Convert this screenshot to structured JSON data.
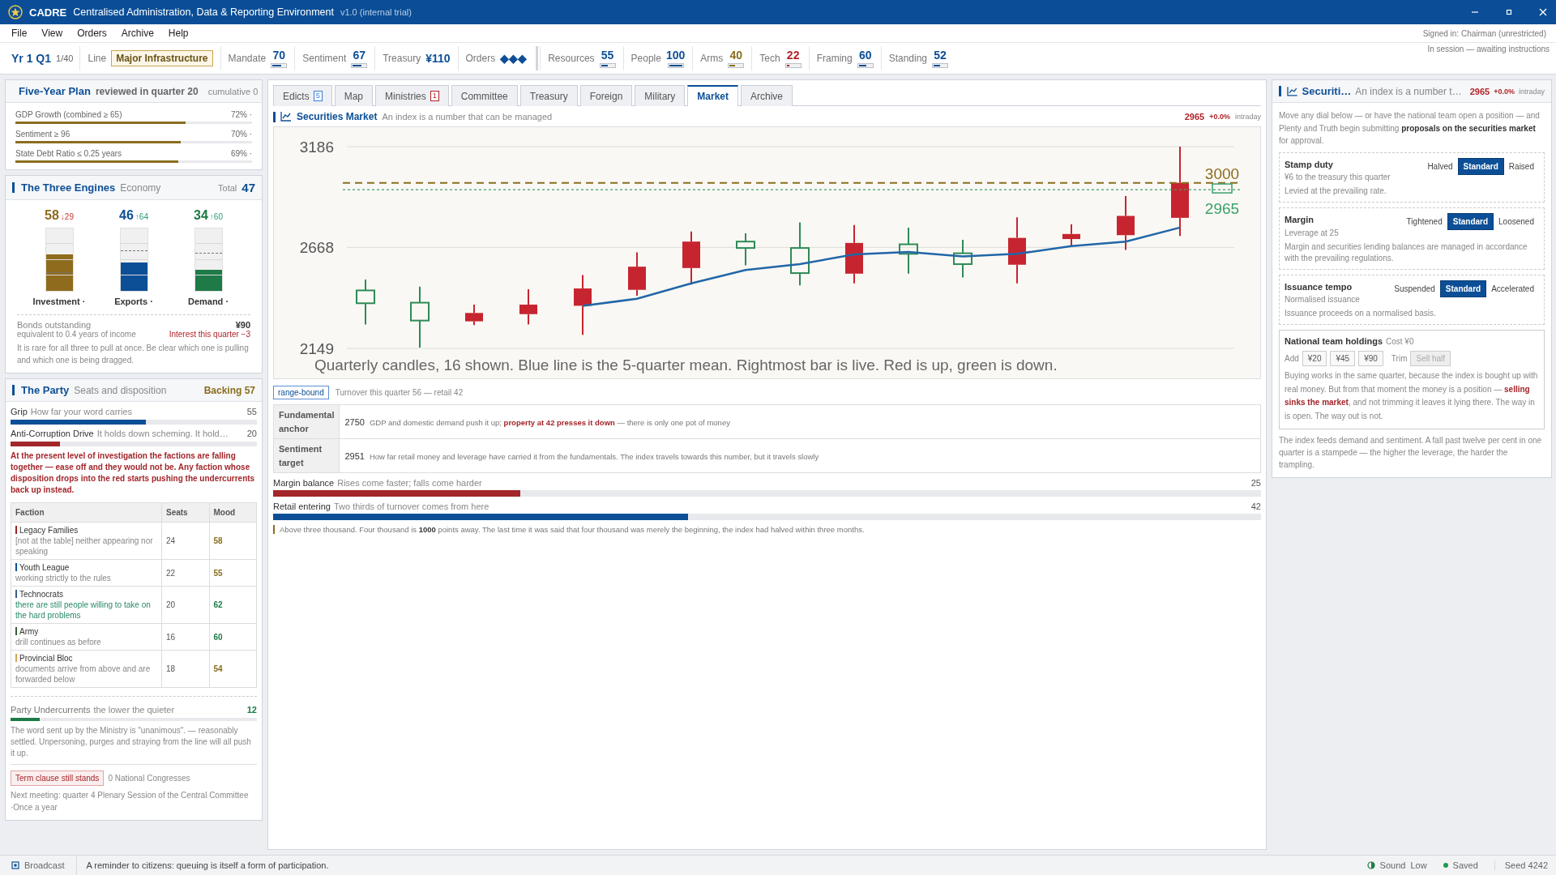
{
  "window": {
    "title": "CADRE",
    "subtitle": "Centralised Administration, Data & Reporting Environment",
    "version": "v1.0 (internal trial)"
  },
  "menu": [
    "File",
    "View",
    "Orders",
    "Archive",
    "Help"
  ],
  "session": {
    "signed_in": "Signed in: Chairman (unrestricted)",
    "status": "In session — awaiting instructions"
  },
  "stats_bar": {
    "period": "Yr 1 Q1",
    "turn": "1/40",
    "line_label": "Line",
    "line_value": "Major Infrastructure",
    "stats": [
      {
        "label": "Mandate",
        "value": "70",
        "level": 0.7,
        "color": "#0d4f96"
      },
      {
        "label": "Sentiment",
        "value": "67",
        "level": 0.67,
        "color": "#0d4f96"
      },
      {
        "label": "Treasury",
        "value": "¥110",
        "color": "#0d4f96"
      },
      {
        "label": "Orders",
        "value": "◆◆◆",
        "color": "#0d4f96"
      }
    ],
    "resources": [
      {
        "label": "Resources",
        "value": "55",
        "level": 0.55,
        "color": "#0d4f96"
      },
      {
        "label": "People",
        "value": "100",
        "level": 1,
        "color": "#0d4f96"
      },
      {
        "label": "Arms",
        "value": "40",
        "level": 0.4,
        "color": "#8a6d1e"
      },
      {
        "label": "Tech",
        "value": "22",
        "level": 0.22,
        "color": "#b0252a"
      },
      {
        "label": "Framing",
        "value": "60",
        "level": 0.6,
        "color": "#0d4f96"
      },
      {
        "label": "Standing",
        "value": "52",
        "level": 0.52,
        "color": "#0d4f96"
      }
    ]
  },
  "five_year_plan": {
    "title": "Five-Year Plan",
    "subtitle": "reviewed in quarter 20",
    "note": "cumulative 0",
    "goals": [
      {
        "label": "GDP Growth (combined ≥ 65)",
        "value": "72% ·",
        "level": 0.72
      },
      {
        "label": "Sentiment ≥ 96",
        "value": "70% ·",
        "level": 0.7
      },
      {
        "label": "State Debt Ratio ≤ 0.25 years",
        "value": "69% ·",
        "level": 0.69
      }
    ]
  },
  "three_engines": {
    "title": "The Three Engines",
    "subtitle": "Economy",
    "total_label": "Total",
    "total": "47",
    "engines": [
      {
        "name": "Investment ·",
        "value": "58",
        "delta": "↓29",
        "rising": false,
        "level": 0.58,
        "target": {
          "level": 0.29
        },
        "color": "#8f6b1e"
      },
      {
        "name": "Exports ·",
        "value": "46",
        "delta": "↑64",
        "rising": true,
        "level": 0.46,
        "target": {
          "level": 0.64
        },
        "color": "#0d4f96"
      },
      {
        "name": "Demand ·",
        "value": "34",
        "delta": "↑60",
        "rising": true,
        "level": 0.34,
        "target": {
          "level": 0.6
        },
        "color": "#1e7a46"
      }
    ],
    "bonds_label": "Bonds outstanding",
    "bonds_value": "¥90",
    "bonds_note": "equivalent to 0.4 years of income",
    "interest": "Interest this quarter −3",
    "text": "It is rare for all three to pull at once. Be clear which one is pulling and which one is being dragged."
  },
  "party": {
    "title": "The Party",
    "subtitle": "Seats and disposition",
    "backing": "Backing 57",
    "meters": [
      {
        "name": "Grip",
        "desc": "How far your word carries",
        "value": "55",
        "level": 0.55,
        "color": "#0d4f96"
      },
      {
        "name": "Anti-Corruption Drive",
        "desc": "It holds down scheming. It hold…",
        "value": "20",
        "level": 0.2,
        "color": "#a3262a"
      }
    ],
    "warning": "At the present level of investigation the factions are falling together — ease off and they would not be. Any faction whose disposition drops into the red starts pushing the undercurrents back up instead.",
    "table": {
      "columns": [
        "Faction",
        "Seats",
        "Mood"
      ],
      "rows": [
        {
          "name": "Legacy Families",
          "note": "[not at the table] neither appearing nor speaking",
          "note_highlighted": false,
          "color": "#9b2226",
          "seats": "24",
          "mood": "58",
          "mood_good": false
        },
        {
          "name": "Youth League",
          "note": "working strictly to the rules",
          "note_highlighted": false,
          "color": "#0d4f96",
          "seats": "22",
          "mood": "55",
          "mood_good": false
        },
        {
          "name": "Technocrats",
          "note": "there are still people willing to take on the hard problems",
          "note_highlighted": true,
          "color": "#3a5a8c",
          "seats": "20",
          "mood": "62",
          "mood_good": true
        },
        {
          "name": "Army",
          "note": "drill continues as before",
          "note_highlighted": false,
          "color": "#3d5a3a",
          "seats": "16",
          "mood": "60",
          "mood_good": true
        },
        {
          "name": "Provincial Bloc",
          "note": "documents arrive from above and are forwarded below",
          "note_highlighted": false,
          "color": "#d4a55a",
          "seats": "18",
          "mood": "54",
          "mood_good": false
        }
      ]
    },
    "undercurrents": {
      "name": "Party Undercurrents",
      "desc": "the lower the quieter",
      "value": "12",
      "level": 0.12,
      "color": "#1e7a46"
    },
    "undercurrents_text": "The word sent up by the Ministry is \"unanimous\". — reasonably settled. Unpersoning, purges and straying from the line will all push it up.",
    "term_tag": "Term clause still stands",
    "congresses": "0 National Congresses",
    "next_meeting": "Next meeting: quarter 4 Plenary Session of the Central Committee  ·Once a year"
  },
  "tabs": [
    {
      "label": "Edicts",
      "badge": "5",
      "badge_alert": false,
      "selected": false
    },
    {
      "label": "Map",
      "selected": false
    },
    {
      "label": "Ministries",
      "badge": "1",
      "badge_alert": true,
      "selected": false
    },
    {
      "label": "Committee",
      "selected": false
    },
    {
      "label": "Treasury",
      "selected": false
    },
    {
      "label": "Foreign",
      "selected": false
    },
    {
      "label": "Military",
      "selected": false
    },
    {
      "label": "Market",
      "selected": true
    },
    {
      "label": "Archive",
      "selected": false
    }
  ],
  "market": {
    "title": "Securities Market",
    "subtitle": "An index is a number that can be managed",
    "index": "2965",
    "change": "+0.0%",
    "change_suffix": "intraday",
    "chart_data": {
      "type": "line",
      "ylim": [
        2149,
        3186
      ],
      "yticks": [
        2149,
        2668,
        3186
      ],
      "series": [
        {
          "color": "#2166a8",
          "values": [
            null,
            null,
            null,
            null,
            2368,
            2404,
            2483,
            2552,
            2582,
            2632,
            2645,
            2622,
            2635,
            2675,
            2698,
            2770
          ]
        }
      ],
      "ref_lines": [
        {
          "axis": "y",
          "value": 3000,
          "label": "3000",
          "color": "#8a6d1e"
        },
        {
          "axis": "y",
          "value": 2965,
          "label": "2965",
          "color": "#3aa06a"
        }
      ]
    },
    "caption": "Quarterly candles, 16 shown. Blue line is the 5-quarter mean. Rightmost bar is live. Red is up, green is down.",
    "regime": "range-bound",
    "turnover": "Turnover this quarter 56 — retail 42",
    "anchors": [
      {
        "label": "Fundamental anchor",
        "value": "2750",
        "text": "GDP and domestic demand push it up; **property at 42 presses it down** — there is only one pot of money"
      },
      {
        "label": "Sentiment target",
        "value": "2951",
        "text": "How far retail money and leverage have carried it from the fundamentals. The index travels towards this number, but it travels slowly"
      }
    ],
    "meters": [
      {
        "name": "Margin balance",
        "desc": "Rises come faster; falls come harder",
        "value": "25",
        "level": 0.25,
        "color": "#a3262a"
      },
      {
        "name": "Retail entering",
        "desc": "Two thirds of turnover comes from here",
        "value": "42",
        "level": 0.42,
        "color": "#0d4f96"
      }
    ],
    "quote": "Above three thousand. Four thousand is **1000** points away. The last time it was said that four thousand was merely the beginning, the index had halved within three months."
  },
  "side_panel": {
    "title": "Securiti…",
    "subtitle": "An index is a number t…",
    "index": "2965",
    "change": "+0.0%",
    "change_suffix": "intraday",
    "intro": "Move any dial below — or have the national team open a position — and Plenty and Truth begin submitting **proposals on the securities market** for approval.",
    "dials": [
      {
        "name": "Stamp duty",
        "desc": "¥6 to the treasury this quarter",
        "note": "Levied at the prevailing rate.",
        "options": [
          {
            "label": "Halved",
            "selected": false
          },
          {
            "label": "Standard",
            "selected": true
          },
          {
            "label": "Raised",
            "selected": false
          }
        ]
      },
      {
        "name": "Margin",
        "desc": "Leverage at 25",
        "note": "Margin and securities lending balances are managed in accordance with the prevailing regulations.",
        "options": [
          {
            "label": "Tightened",
            "selected": false
          },
          {
            "label": "Standard",
            "selected": true
          },
          {
            "label": "Loosened",
            "selected": false
          }
        ]
      },
      {
        "name": "Issuance tempo",
        "desc": "Normalised issuance",
        "note": "Issuance proceeds on a normalised basis.",
        "options": [
          {
            "label": "Suspended",
            "selected": false
          },
          {
            "label": "Standard",
            "selected": true
          },
          {
            "label": "Accelerated",
            "selected": false
          }
        ]
      }
    ],
    "holdings": {
      "title": "National team holdings",
      "cost": "Cost ¥0",
      "add_label": "Add",
      "amounts": [
        "¥20",
        "¥45",
        "¥90"
      ],
      "trim_label": "Trim",
      "sell": {
        "label": "Sell half",
        "disabled": true
      },
      "text": "Buying works in the same quarter, because the index is bought up with real money. But from that moment the money is a position — **selling sinks the market**, and not trimming it leaves it lying there. The way in is open. The way out is not."
    },
    "footer": "The index feeds demand and sentiment. A fall past twelve per cent in one quarter is a stampede — the higher the leverage, the harder the trampling."
  },
  "status_bar": {
    "channel": "Broadcast",
    "message": "A reminder to citizens: queuing is itself a form of participation.",
    "sound_label": "Sound",
    "sound_value": "Low",
    "saved": "Saved",
    "seed": "Seed 4242"
  }
}
